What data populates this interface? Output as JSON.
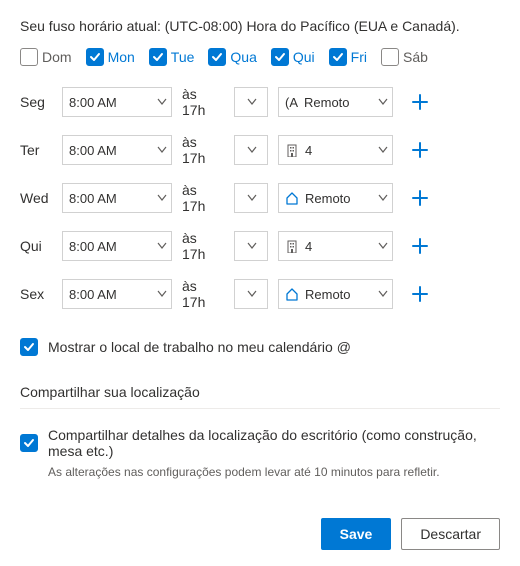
{
  "timezone_line": "Seu fuso horário atual: (UTC-08:00) Hora do Pacífico (EUA e Canadá).",
  "days": [
    {
      "label": "Dom",
      "checked": false
    },
    {
      "label": "Mon",
      "checked": true
    },
    {
      "label": "Tue",
      "checked": true
    },
    {
      "label": "Qua",
      "checked": true
    },
    {
      "label": "Qui",
      "checked": true
    },
    {
      "label": "Fri",
      "checked": true
    },
    {
      "label": "Sáb",
      "checked": false
    }
  ],
  "rows": [
    {
      "label": "Seg",
      "start": "8:00 AM",
      "mid": "às 17h",
      "loc_prefix": "(A",
      "loc_icon": "none",
      "loc_text": "Remoto"
    },
    {
      "label": "Ter",
      "start": "8:00 AM",
      "mid": "às 17h",
      "loc_prefix": "",
      "loc_icon": "building",
      "loc_text": "4"
    },
    {
      "label": "Wed",
      "start": "8:00 AM",
      "mid": "às 17h",
      "loc_prefix": "",
      "loc_icon": "home",
      "loc_text": "Remoto"
    },
    {
      "label": "Qui",
      "start": "8:00 AM",
      "mid": "às 17h",
      "loc_prefix": "",
      "loc_icon": "building",
      "loc_text": "4"
    },
    {
      "label": "Sex",
      "start": "8:00 AM",
      "mid": "às 17h",
      "loc_prefix": "",
      "loc_icon": "home",
      "loc_text": "Remoto"
    }
  ],
  "show_location_label": "Mostrar o local de trabalho no meu calendário @",
  "share_section_title": "Compartilhar sua localização",
  "share_details_label": "Compartilhar detalhes da localização do escritório (como construção, mesa etc.)",
  "share_note": "As alterações nas configurações podem levar até 10 minutos para refletir.",
  "buttons": {
    "save": "Save",
    "discard": "Descartar"
  }
}
